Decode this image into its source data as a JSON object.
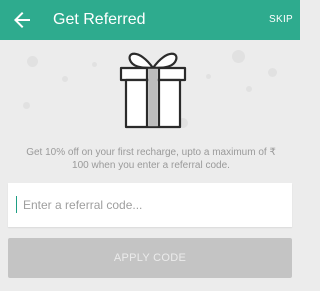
{
  "appbar": {
    "title": "Get Referred",
    "skip_label": "SKIP",
    "color": "#2eab8e"
  },
  "hero": {
    "icon": "gift-icon"
  },
  "promo": {
    "text": "Get 10% off on your first recharge, upto a maximum of ₹ 100 when you enter a referral code."
  },
  "referral": {
    "value": "",
    "placeholder": "Enter a referral code..."
  },
  "apply_button": {
    "label": "APPLY CODE",
    "state": "disabled"
  },
  "icons": {
    "back": "back-arrow-icon"
  }
}
